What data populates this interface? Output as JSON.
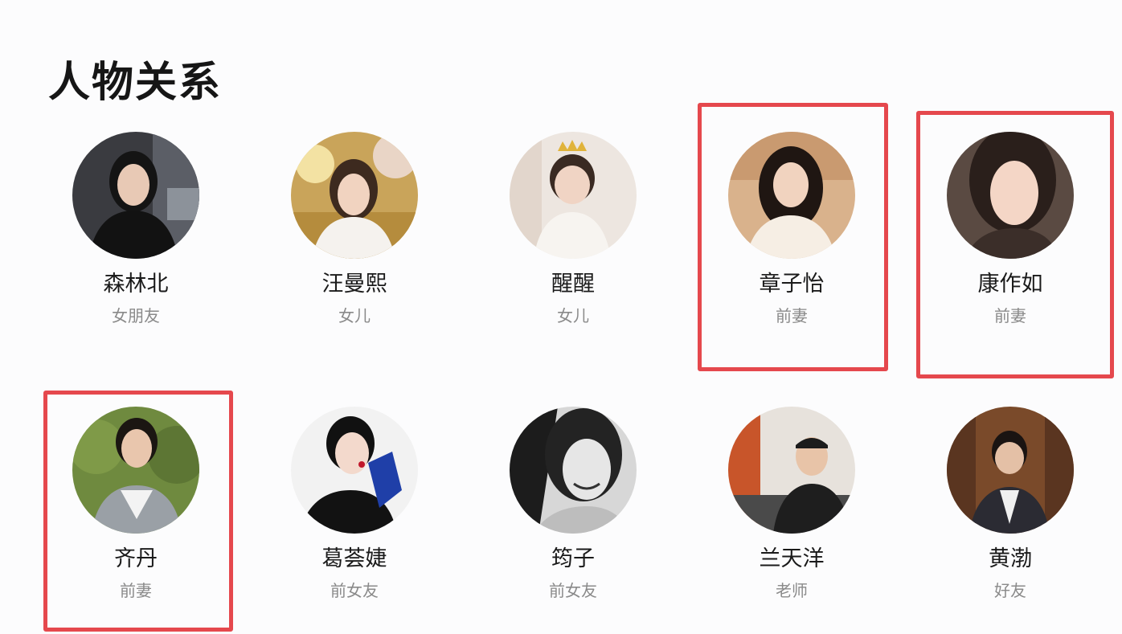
{
  "section": {
    "title": "人物关系"
  },
  "people": [
    {
      "name": "森林北",
      "relation": "女朋友",
      "photo": "portrait-photo"
    },
    {
      "name": "汪曼熙",
      "relation": "女儿",
      "photo": "portrait-photo"
    },
    {
      "name": "醒醒",
      "relation": "女儿",
      "photo": "portrait-photo"
    },
    {
      "name": "章子怡",
      "relation": "前妻",
      "photo": "portrait-photo",
      "highlighted": true
    },
    {
      "name": "康作如",
      "relation": "前妻",
      "photo": "portrait-photo",
      "highlighted": true
    },
    {
      "name": "齐丹",
      "relation": "前妻",
      "photo": "portrait-photo",
      "highlighted": true
    },
    {
      "name": "葛荟婕",
      "relation": "前女友",
      "photo": "portrait-photo"
    },
    {
      "name": "筠子",
      "relation": "前女友",
      "photo": "portrait-photo"
    },
    {
      "name": "兰天洋",
      "relation": "老师",
      "photo": "portrait-photo"
    },
    {
      "name": "黄渤",
      "relation": "好友",
      "photo": "portrait-photo"
    }
  ],
  "colors": {
    "highlight": "#e5484d",
    "name_text": "#1a1a1a",
    "relation_text": "#8a8a8a",
    "background": "#fcfcfd"
  }
}
